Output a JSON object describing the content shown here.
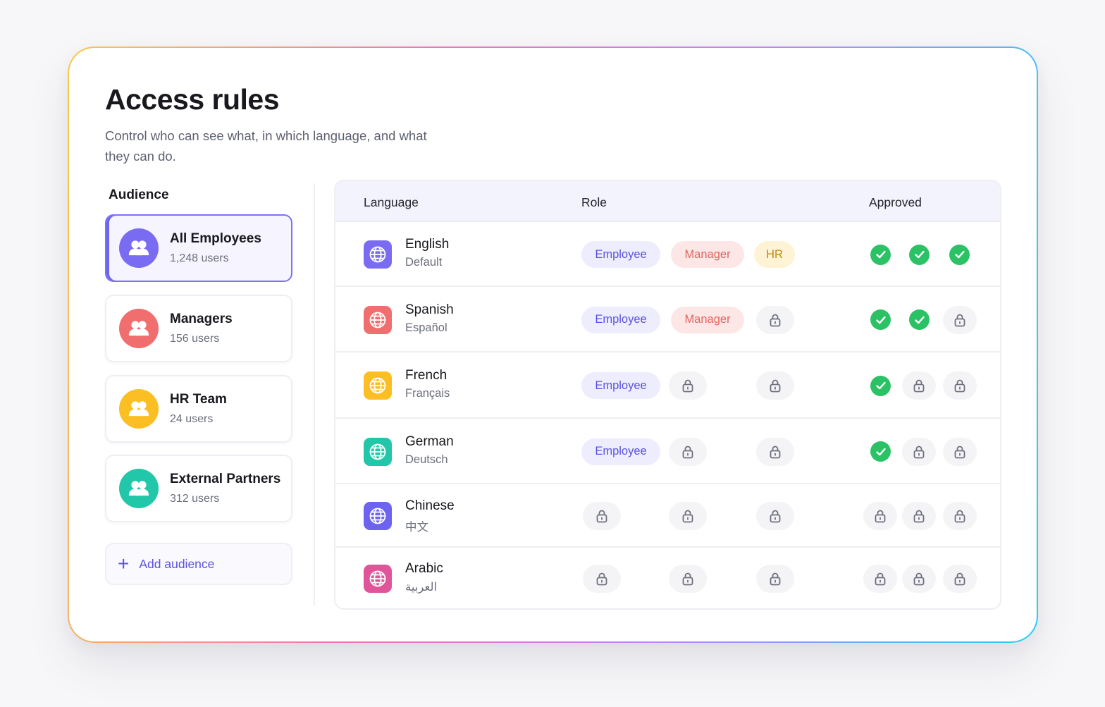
{
  "header": {
    "title": "Access rules",
    "subtitle": "Control who can see what, in which language, and what they can do."
  },
  "audience": {
    "title": "Audience",
    "items": [
      {
        "name": "All Employees",
        "count": "1,248 users",
        "color": "#7a6cf2",
        "active": true
      },
      {
        "name": "Managers",
        "count": "156 users",
        "color": "#f06e6e",
        "active": false
      },
      {
        "name": "HR Team",
        "count": "24 users",
        "color": "#fbbf24",
        "active": false
      },
      {
        "name": "External Partners",
        "count": "312 users",
        "color": "#22c7a9",
        "active": false
      }
    ],
    "add_label": "Add audience"
  },
  "table": {
    "columns": {
      "language": "Language",
      "role": "Role",
      "approved": "Approved"
    },
    "rows": [
      {
        "name": "English",
        "native": "Default",
        "icon_color": "#7a6cf2",
        "roles": [
          "Employee",
          "Manager",
          "HR"
        ],
        "approved": [
          true,
          true,
          true
        ]
      },
      {
        "name": "Spanish",
        "native": "Español",
        "icon_color": "#f06e6e",
        "roles": [
          "Employee",
          "Manager",
          null
        ],
        "approved": [
          true,
          true,
          false
        ]
      },
      {
        "name": "French",
        "native": "Français",
        "icon_color": "#fbbf24",
        "roles": [
          "Employee",
          null,
          null
        ],
        "approved": [
          true,
          false,
          false
        ]
      },
      {
        "name": "German",
        "native": "Deutsch",
        "icon_color": "#22c7a9",
        "roles": [
          "Employee",
          null,
          null
        ],
        "approved": [
          true,
          false,
          false
        ]
      },
      {
        "name": "Chinese",
        "native": "中文",
        "icon_color": "#6c63f0",
        "roles": [
          null,
          null,
          null
        ],
        "approved": [
          false,
          false,
          false
        ]
      },
      {
        "name": "Arabic",
        "native": "العربية",
        "icon_color": "#e05599",
        "roles": [
          null,
          null,
          null
        ],
        "approved": [
          false,
          false,
          false
        ]
      }
    ]
  },
  "icons": {
    "audience": "users-icon",
    "language": "globe-icon",
    "locked": "lock-icon",
    "approved": "check-icon",
    "add": "plus-icon"
  }
}
